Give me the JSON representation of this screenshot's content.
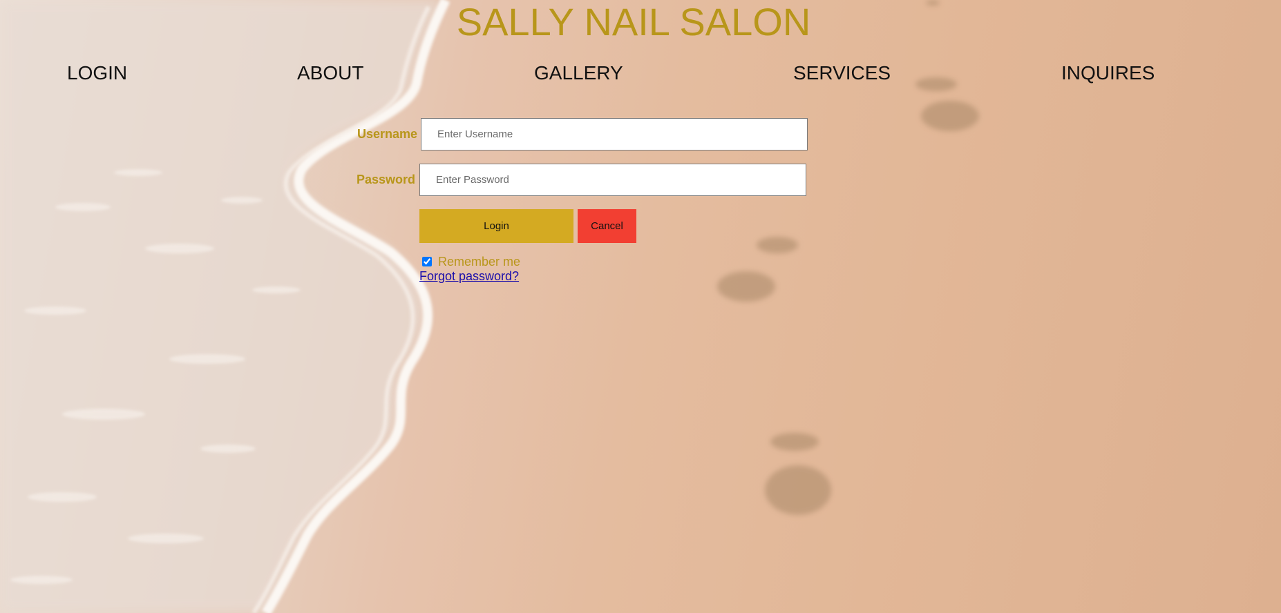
{
  "site": {
    "title": "SALLY NAIL SALON"
  },
  "nav": {
    "items": [
      {
        "label": "LOGIN"
      },
      {
        "label": "ABOUT"
      },
      {
        "label": "GALLERY"
      },
      {
        "label": "SERVICES"
      },
      {
        "label": "INQUIRES"
      }
    ]
  },
  "login_form": {
    "username_label": "Username",
    "username_placeholder": "Enter Username",
    "username_value": "",
    "password_label": "Password",
    "password_placeholder": "Enter Password",
    "password_value": "",
    "login_button": "Login",
    "cancel_button": "Cancel",
    "remember_label": "Remember me",
    "remember_checked": true,
    "forgot_link": "Forgot password?"
  },
  "colors": {
    "brand_gold": "#b8961a",
    "login_button": "#d4aa22",
    "cancel_button": "#f23f32",
    "link": "#1a0dab"
  }
}
